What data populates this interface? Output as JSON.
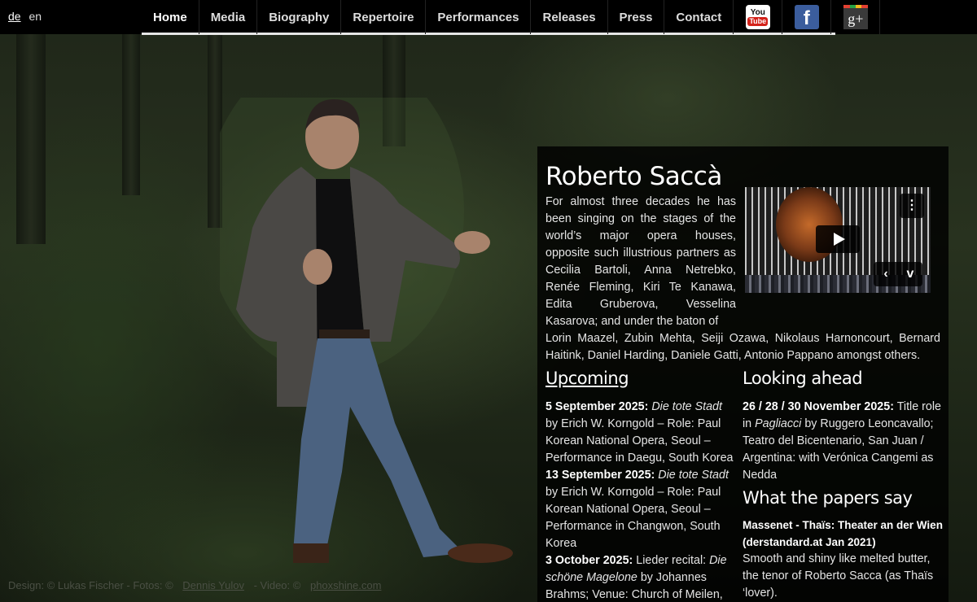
{
  "lang": {
    "de": "de",
    "en": "en"
  },
  "nav": [
    "Home",
    "Media",
    "Biography",
    "Repertoire",
    "Performances",
    "Releases",
    "Press",
    "Contact"
  ],
  "social": [
    {
      "icon": "youtube-icon",
      "top": "You",
      "bottom": "Tube"
    },
    {
      "icon": "facebook-icon",
      "glyph": "f"
    },
    {
      "icon": "google-plus-icon",
      "glyph": "g+"
    }
  ],
  "main": {
    "name": "Roberto Saccà",
    "bio_narrow": "For almost three decades he has been singing on the stages of the world’s major opera houses, opposite such illustrious partners as Cecilia Bartoli, Anna Netrebko, Renée Fleming, Kiri Te Kanawa, Edita Gruberova, Vesselina Kasarova; and under the baton of",
    "bio_wide": "Lorin Maazel, Zubin Mehta, Seiji Ozawa, Nikolaus Harnoncourt, Bernard Haitink, Daniel Harding, Daniele Gatti, Antonio Pappano amongst others."
  },
  "video": {
    "more": "⋮",
    "prev": "‹",
    "vimeo": "v"
  },
  "upcoming": {
    "title": "Upcoming",
    "e1_date": "5 September 2025:",
    "e1_work": "Die tote Stadt",
    "e1_text": "by Erich W. Korngold – Role: Paul Korean National Opera, Seoul – Performance in Daegu, South Korea",
    "e2_date": "13 September 2025:",
    "e2_work": "Die tote Stadt",
    "e2_text": "by Erich W. Korngold – Role: Paul Korean National Opera, Seoul – Performance in Changwon, South Korea",
    "e3_date": "3 October 2025:",
    "e3_pre": "Lieder recital:",
    "e3_work": "Die schöne Magelone",
    "e3_text": "by Johannes Brahms; Venue: Church of Meilen,"
  },
  "ahead": {
    "title": "Looking ahead",
    "date": "26 / 28 / 30 November 2025:",
    "pre": "Title role in",
    "work": "Pagliacci",
    "text": "by Ruggero Leoncavallo; Teatro del Bicentenario, San Juan / Argentina: with Verónica Cangemi as Nedda"
  },
  "papers": {
    "title": "What the papers say",
    "article": "Massenet - Thaïs: Theater an der Wien (derstandard.at Jan 2021)",
    "quote": "Smooth and shiny like melted butter, the tenor of Roberto Sacca (as Thaïs ‘lover)."
  },
  "footer": {
    "design": "Design: © Lukas Fischer - Fotos: ©",
    "photographer": "Dennis Yulov",
    "video": "- Video: ©",
    "video_link": "phoxshine.com"
  },
  "colors": {
    "bar": "#000000",
    "panel": "rgba(0,0,0,0.82)",
    "youtube": "#d3221a",
    "facebook": "#3b5d9d"
  }
}
